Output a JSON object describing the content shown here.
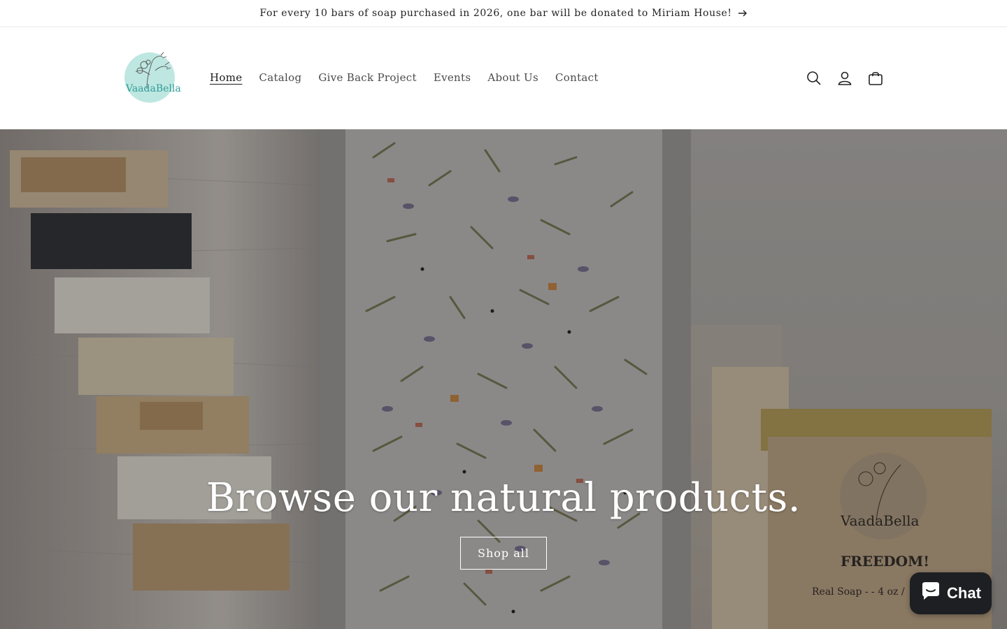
{
  "announcement": {
    "text": "For every 10 bars of soap purchased in 2026, one bar will be donated to Miriam House!",
    "icon": "arrow-right-icon"
  },
  "header": {
    "logo_text": "VaadaBella",
    "nav": [
      {
        "label": "Home",
        "active": true
      },
      {
        "label": "Catalog",
        "active": false
      },
      {
        "label": "Give Back Project",
        "active": false
      },
      {
        "label": "Events",
        "active": false
      },
      {
        "label": "About Us",
        "active": false
      },
      {
        "label": "Contact",
        "active": false
      }
    ],
    "icons": [
      "search-icon",
      "account-icon",
      "cart-icon"
    ]
  },
  "hero": {
    "title": "Browse our natural products.",
    "button_label": "Shop all",
    "product_label_brand": "VaadaBella",
    "product_label_name": "FREEDOM!",
    "product_label_detail": "Real Soap - - 4 oz /"
  },
  "chat": {
    "label": "Chat",
    "icon": "chat-bubble-icon"
  },
  "colors": {
    "logo_circle": "#bfe7e1",
    "logo_text": "#2f9c9a",
    "chat_bg": "#1d1f22"
  }
}
